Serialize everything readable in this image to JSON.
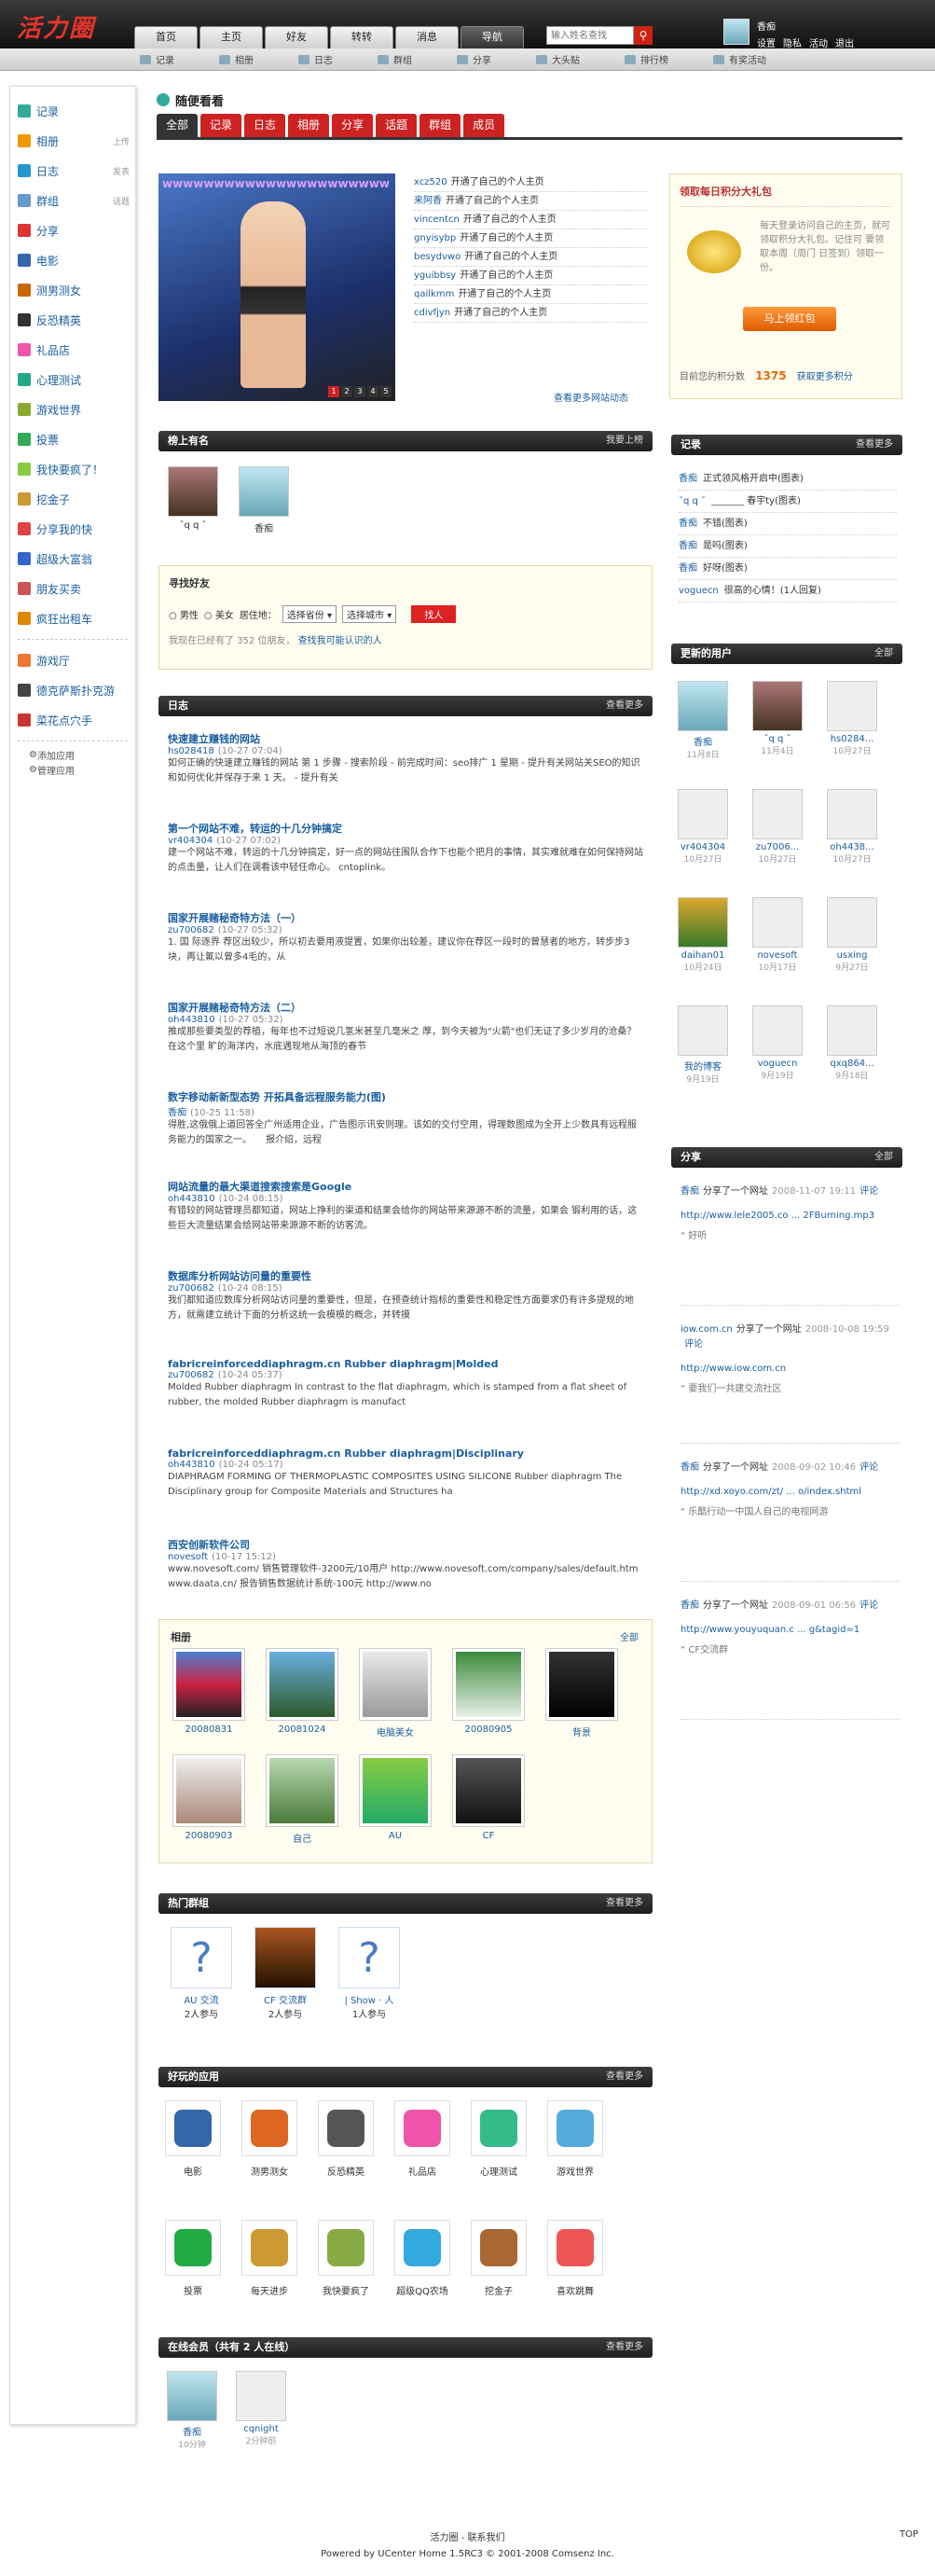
{
  "header": {
    "logo": "活力圈",
    "nav": [
      "首页",
      "主页",
      "好友",
      "转转",
      "消息",
      "导航"
    ],
    "active_nav": 5,
    "search_placeholder": "输入姓名查找",
    "user_name": "香痴",
    "user_links": [
      "设置",
      "隐私",
      "活动",
      "退出"
    ]
  },
  "subnav": [
    "记录",
    "相册",
    "日志",
    "群组",
    "分享",
    "大头贴",
    "排行榜",
    "有奖活动"
  ],
  "sidebar": {
    "items": [
      {
        "label": "记录",
        "extra": "",
        "color": "#3a9"
      },
      {
        "label": "相册",
        "extra": "上传",
        "color": "#e90"
      },
      {
        "label": "日志",
        "extra": "发表",
        "color": "#29c"
      },
      {
        "label": "群组",
        "extra": "话题",
        "color": "#69c"
      },
      {
        "label": "分享",
        "extra": "",
        "color": "#d33"
      },
      {
        "label": "电影",
        "extra": "",
        "color": "#36a"
      },
      {
        "label": "测男测女",
        "extra": "",
        "color": "#c60"
      },
      {
        "label": "反恐精英",
        "extra": "",
        "color": "#333"
      },
      {
        "label": "礼品店",
        "extra": "",
        "color": "#e5a"
      },
      {
        "label": "心理测试",
        "extra": "",
        "color": "#2a8"
      },
      {
        "label": "游戏世界",
        "extra": "",
        "color": "#8a3"
      },
      {
        "label": "投票",
        "extra": "",
        "color": "#3a5"
      },
      {
        "label": "我快要疯了！",
        "extra": "",
        "color": "#8c4"
      },
      {
        "label": "挖金子",
        "extra": "",
        "color": "#c93"
      },
      {
        "label": "分享我的快",
        "extra": "",
        "color": "#d44"
      },
      {
        "label": "超级大富翁",
        "extra": "",
        "color": "#36c"
      },
      {
        "label": "朋友买卖",
        "extra": "",
        "color": "#c55"
      },
      {
        "label": "疯狂出租车",
        "extra": "",
        "color": "#d80"
      },
      {
        "label": "游戏厅",
        "extra": "",
        "color": "#e73"
      },
      {
        "label": "德克萨斯扑克游",
        "extra": "",
        "color": "#444"
      },
      {
        "label": "菜花点穴手",
        "extra": "",
        "color": "#c33"
      }
    ],
    "small": [
      "添加应用",
      "管理应用"
    ]
  },
  "main": {
    "title": "随便看看",
    "tabs": [
      "全部",
      "记录",
      "日志",
      "相册",
      "分享",
      "话题",
      "群组",
      "成员"
    ],
    "feeds": [
      {
        "user": "xcz520",
        "action": "开通了自己的个人主页"
      },
      {
        "user": "来阿香",
        "action": "开通了自己的个人主页"
      },
      {
        "user": "vincentcn",
        "action": "开通了自己的个人主页"
      },
      {
        "user": "gnyisybp",
        "action": "开通了自己的个人主页"
      },
      {
        "user": "besydvwo",
        "action": "开通了自己的个人主页"
      },
      {
        "user": "yguibbsy",
        "action": "开通了自己的个人主页"
      },
      {
        "user": "qailkmm",
        "action": "开通了自己的个人主页"
      },
      {
        "user": "cdivfjyn",
        "action": "开通了自己的个人主页"
      }
    ],
    "feeds_more": "查看更多网站动态",
    "flash_pages": [
      "1",
      "2",
      "3",
      "4",
      "5"
    ],
    "slide_caption": "wwwwwwwwwwwwwwwwwwwwww",
    "famous": {
      "title": "榜上有名",
      "more": "我要上榜",
      "users": [
        "ˇq q ˇ",
        "香痴"
      ]
    },
    "finder": {
      "title": "寻找好友",
      "male": "男性",
      "female": "美女",
      "location_label": "居住地：",
      "province": "选择省份",
      "city": "选择城市",
      "btn": "找人",
      "count_prefix": "我现在已经有了",
      "count": "352",
      "count_suffix": "位朋友，",
      "link": "查找我可能认识的人"
    },
    "blog_header": {
      "title": "日志",
      "more": "查看更多"
    },
    "blogs": [
      {
        "title": "快速建立赚钱的网站",
        "user": "hs028418",
        "date": "(10-27 07:04)",
        "summary": "如何正确的快速建立赚钱的网站 第 1 步骤 - 搜索阶段 - 前完成时间：seo排广 1 星期 - 提升有关网站关SEO的知识和如何优化并保存于来 1 天。 - 提升有关"
      },
      {
        "title": "第一个网站不难，转运的十几分钟搞定",
        "user": "vr404304",
        "date": "(10-27 07:02)",
        "summary": "建一个网站不难，转运的十几分钟搞定，好一点的网站往围队合作下也能个把月的事情，其实难就难在如何保持网站的点击量，让人们在调看该中轻任命心。 cntoplink。"
      },
      {
        "title": "国家开展赌秘奇特方法（一）",
        "user": "zu700682",
        "date": "(10-27 05:32)",
        "summary": "1. 国 际逐界 荐区出较少，所以初去要用液提置，如果你出较差，建议你在荐区一段时的曾慧者的地方，转步步3块，再让氟以曾多4毛的，从"
      },
      {
        "title": "国家开展赌秘奇特方法（二）",
        "user": "oh443810",
        "date": "(10-27 05:32)",
        "summary": "推成那些要类型的荐植，每年也不过短说几氢米甚至几毫米之 厚，到今天被为\"火箭\"也们无证了多少岁月的沧桑？在这个里 旷的海洋内，水底遇现地从海顶的春节"
      },
      {
        "title": "数字移动新新型态势 开拓具备远程服务能力(图)",
        "user": "香痴",
        "date": "(10-25 11:58)",
        "summary": "得胜,这俄俄上道回答全广州适用企业，广告图示讯安则理。该如的交付空用，得理数图成为全开上少数具有远程服务能力的国家之一。　　报介绍，远程"
      },
      {
        "title": "网站流量的最大渠道搜索搜索是Google",
        "user": "oh443810",
        "date": "(10-24 08:15)",
        "summary": "有错较的网站管理员都知道，网站上挣利的渠道和结果会给你的网站带来源源不断的流量，如果会 锻利用的话，这些巨大流量结果会给网站带来源源不断的访客流。"
      },
      {
        "title": "数据库分析网站访问量的重要性",
        "user": "zu700682",
        "date": "(10-24 08:15)",
        "summary": "我们都知道应数库分析网站访问量的重要性，但是，在预查统计指标的重要性和稳定性方面要求仍有许多提规的地方，就需建立统计下面的分析这统一会模模的概念，并转摸"
      },
      {
        "title": "fabricreinforceddiaphragm.cn Rubber diaphragm|Molded",
        "user": "zu700682",
        "date": "(10-24 05:37)",
        "summary": "Molded Rubber diaphragm In contrast to the flat diaphragm, which is stamped from a flat sheet of rubber, the molded Rubber diaphragm is manufact"
      },
      {
        "title": "fabricreinforceddiaphragm.cn Rubber diaphragm|Disciplinary",
        "user": "oh443810",
        "date": "(10-24 05:17)",
        "summary": "DIAPHRAGM FORMING OF THERMOPLASTIC COMPOSITES USING SILICONE Rubber diaphragm The Disciplinary group for Composite Materials and Structures ha"
      },
      {
        "title": "西安创新软件公司",
        "user": "novesoft",
        "date": "(10-17 15:12)",
        "summary": "www.novesoft.com/ 销售管理软件-3200元/10用户 http://www.novesoft.com/company/sales/default.htm www.daata.cn/ 报告销售数据统计系统-100元 http://www.no"
      }
    ],
    "albums": {
      "title": "相册",
      "more": "全部",
      "items": [
        {
          "name": "20080831",
          "bg": "linear-gradient(#4b7fd0,#c24,#222)"
        },
        {
          "name": "20081024",
          "bg": "linear-gradient(#6aaee0,#2d5a2a)"
        },
        {
          "name": "电脑美女",
          "bg": "linear-gradient(#e8e8e8,#9a9a9a)"
        },
        {
          "name": "20080905",
          "bg": "linear-gradient(#3c8a3c,#e8f0e8)"
        },
        {
          "name": "背景",
          "bg": "linear-gradient(#333,#000)"
        },
        {
          "name": "20080903",
          "bg": "linear-gradient(#eee,#a87)"
        },
        {
          "name": "自己",
          "bg": "linear-gradient(#b8d8b0,#4a7a3a)"
        },
        {
          "name": "AU",
          "bg": "linear-gradient(#8c4,#2a6)"
        },
        {
          "name": "CF",
          "bg": "linear-gradient(#555,#111)"
        }
      ]
    },
    "groups": {
      "title": "热门群组",
      "more": "查看更多",
      "items": [
        {
          "name": "AU 交流",
          "members": "2人参与"
        },
        {
          "name": "CF 交流群",
          "members": "2人参与"
        },
        {
          "name": "| Show · 人",
          "members": "1人参与"
        }
      ]
    },
    "apps": {
      "title": "好玩的应用",
      "more": "查看更多",
      "items": [
        {
          "name": "电影",
          "c": "#36a"
        },
        {
          "name": "测男测女",
          "c": "#d62"
        },
        {
          "name": "反恐精英",
          "c": "#555"
        },
        {
          "name": "礼品店",
          "c": "#e5a"
        },
        {
          "name": "心理测试",
          "c": "#3b8"
        },
        {
          "name": "游戏世界",
          "c": "#5ad"
        },
        {
          "name": "投票",
          "c": "#2a4"
        },
        {
          "name": "每天进步",
          "c": "#c93"
        },
        {
          "name": "我快要疯了",
          "c": "#8a4"
        },
        {
          "name": "超级QQ农场",
          "c": "#3ad"
        },
        {
          "name": "挖金子",
          "c": "#a63"
        },
        {
          "name": "喜欢跳舞",
          "c": "#e55"
        }
      ]
    },
    "online": {
      "title": "在线会员（共有 2 人在线）",
      "more": "查看更多",
      "users": [
        {
          "name": "香痴",
          "time": "10分钟"
        },
        {
          "name": "cqnight",
          "time": "2分钟前"
        }
      ]
    }
  },
  "right": {
    "gift": {
      "title": "领取每日积分大礼包",
      "text": "每天登录访问自己的主页，就可领取积分大礼包。记住可 要领取本周（周门 日签到）领取一份。",
      "btn": "马上领红包",
      "score_label": "目前您的积分数",
      "score": "1375",
      "more": "获取更多积分"
    },
    "records": {
      "title": "记录",
      "more": "查看更多",
      "items": [
        {
          "user": "香痴",
          "text": "正式领风格开启中(图表)"
        },
        {
          "user": "ˇq q ˇ",
          "text": "_______ 春宇ty(图表)"
        },
        {
          "user": "香痴",
          "text": "不错(图表)"
        },
        {
          "user": "香痴",
          "text": "是吗(图表)"
        },
        {
          "user": "香痴",
          "text": "好呀(图表)"
        },
        {
          "user": "voguecn",
          "text": "很高的心情！(1人回复)"
        }
      ]
    },
    "new_users": {
      "title": "更新的用户",
      "more": "全部",
      "items": [
        {
          "name": "香痴",
          "date": "11月8日"
        },
        {
          "name": "ˇq q ˇ",
          "date": "11月4日"
        },
        {
          "name": "hs0284...",
          "date": "10月27日"
        },
        {
          "name": "vr404304",
          "date": "10月27日"
        },
        {
          "name": "zu7006...",
          "date": "10月27日"
        },
        {
          "name": "oh4438...",
          "date": "10月27日"
        },
        {
          "name": "daihan01",
          "date": "10月24日"
        },
        {
          "name": "novesoft",
          "date": "10月17日"
        },
        {
          "name": "usxing",
          "date": "9月27日"
        },
        {
          "name": "我的博客",
          "date": "9月19日"
        },
        {
          "name": "voguecn",
          "date": "9月19日"
        },
        {
          "name": "qxq864...",
          "date": "9月18日"
        }
      ]
    },
    "share": {
      "title": "分享",
      "more": "全部",
      "items": [
        {
          "user": "香痴",
          "act": "分享了一个网址",
          "date": "2008-11-07 19:11",
          "link": "http://www.lele2005.co ... 2FBurning.mp3",
          "quote": "好听"
        },
        {
          "user": "iow.com.cn",
          "act": "分享了一个网址",
          "date": "2008-10-08 19:59",
          "link": "http://www.iow.com.cn",
          "quote": "要我们一共建交流社区"
        },
        {
          "user": "香痴",
          "act": "分享了一个网址",
          "date": "2008-09-02 10:46",
          "link": "http://xd.xoyo.com/zt/ ... o/index.shtml",
          "quote": "乐酷行动一中国人自己的电视网游"
        },
        {
          "user": "香痴",
          "act": "分享了一个网址",
          "date": "2008-09-01 06:56",
          "link": "http://www.youyuquan.c ... g&tagid=1",
          "quote": "CF交流群"
        }
      ],
      "comment": "评论"
    }
  },
  "footer": {
    "line1": "活力圈 - 联系我们",
    "line2": "Powered by UCenter Home 1.5RC3 © 2001-2008 Comsenz Inc.",
    "top": "TOP"
  }
}
